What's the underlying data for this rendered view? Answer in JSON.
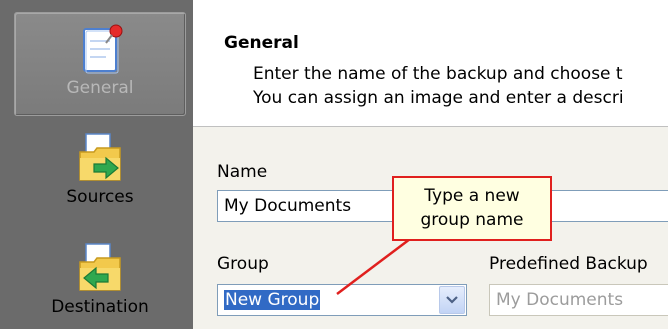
{
  "sidebar": {
    "items": [
      {
        "label": "General",
        "icon": "note-pin-icon",
        "selected": true
      },
      {
        "label": "Sources",
        "icon": "folder-arrow-icon",
        "selected": false
      },
      {
        "label": "Destination",
        "icon": "folder-arrow-icon",
        "selected": false
      }
    ]
  },
  "header": {
    "title": "General",
    "line1": "Enter the name of the backup and choose t",
    "line2": "You can assign an image and enter a descri"
  },
  "form": {
    "name_label": "Name",
    "name_value": "My Documents",
    "group_label": "Group",
    "group_value": "New Group",
    "predefined_label": "Predefined Backup",
    "predefined_value": "My Documents"
  },
  "callout": {
    "line1": "Type a new",
    "line2": "group name",
    "color": "#e0201e"
  },
  "colors": {
    "sidebar": "#6b6b6b",
    "selection": "#316ac5",
    "form_bg": "#f3f2ec"
  }
}
